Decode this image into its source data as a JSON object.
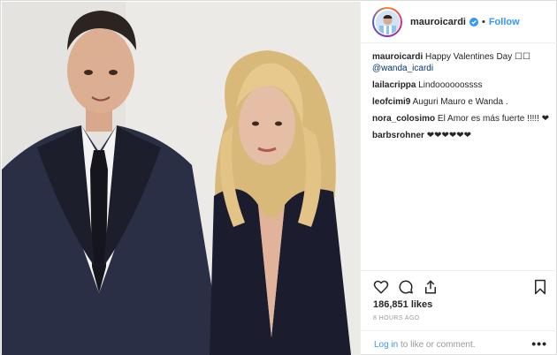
{
  "post": {
    "username": "mauroicardi",
    "follow_label": "Follow",
    "separator": "•",
    "verified_icon": "verified-badge-icon",
    "photo_description_icon": "post-photo"
  },
  "comments": [
    {
      "user": "mauroicardi",
      "text": "Happy Valentines Day ☐☐",
      "mention": "@wanda_icardi"
    },
    {
      "user": "lailacrippa",
      "text": "Lindoooooossss"
    },
    {
      "user": "leofcimi9",
      "text": "Auguri Mauro e Wanda ."
    },
    {
      "user": "nora_colosimo",
      "text": "El Amor es más fuerte !!!!! ❤"
    },
    {
      "user": "barbsrohner",
      "text": "❤❤❤❤❤❤"
    }
  ],
  "actions": {
    "like_icon": "heart-icon",
    "comment_icon": "comment-icon",
    "share_icon": "share-icon",
    "save_icon": "bookmark-icon",
    "likes": "186,851 likes",
    "timestamp": "8 HOURS AGO",
    "login_link": "Log in",
    "login_suffix": " to like or comment.",
    "more": "•••"
  },
  "colors": {
    "link": "#3897f0",
    "text": "#262626",
    "muted": "#999999",
    "border": "#efefef"
  }
}
